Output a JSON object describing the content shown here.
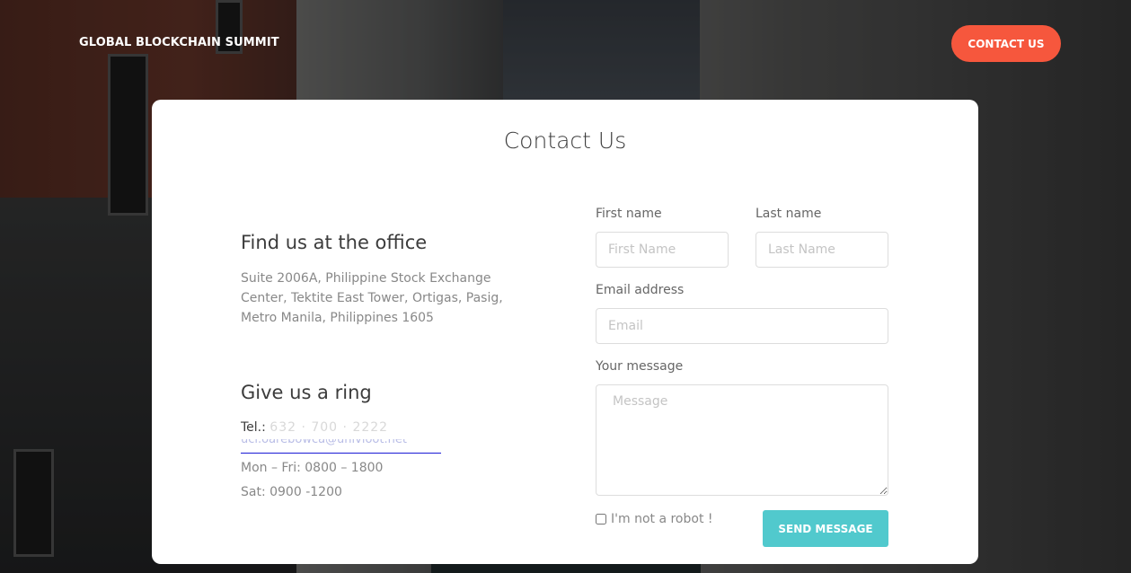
{
  "header": {
    "brand": "GLOBAL BLOCKCHAIN SUMMIT",
    "contact_button": "CONTACT US"
  },
  "card": {
    "title": "Contact Us",
    "office": {
      "heading": "Find us at the office",
      "address": "Suite 2006A, Philippine Stock Exchange Center, Tektite East Tower, Ortigas, Pasig, Metro Manila, Philippines 1605"
    },
    "ring": {
      "heading": "Give us a ring",
      "tel_label": "Tel.:",
      "tel_value": "632 · 700 · 2222",
      "email": "uci.oarebowca@univioot.net",
      "hours_weekday": "Mon – Fri: 0800 – 1800",
      "hours_saturday": "Sat: 0900 -1200"
    },
    "form": {
      "first_name_label": "First name",
      "first_name_placeholder": "First Name",
      "last_name_label": "Last name",
      "last_name_placeholder": "Last Name",
      "email_label": "Email address",
      "email_placeholder": "Email",
      "message_label": "Your message",
      "message_placeholder": "Message",
      "robot_label": "I'm not a robot !",
      "send_button": "SEND MESSAGE"
    }
  },
  "colors": {
    "accent_orange": "#f6573d",
    "accent_teal": "#51c9cd",
    "link_blue": "#1a1ad6"
  }
}
